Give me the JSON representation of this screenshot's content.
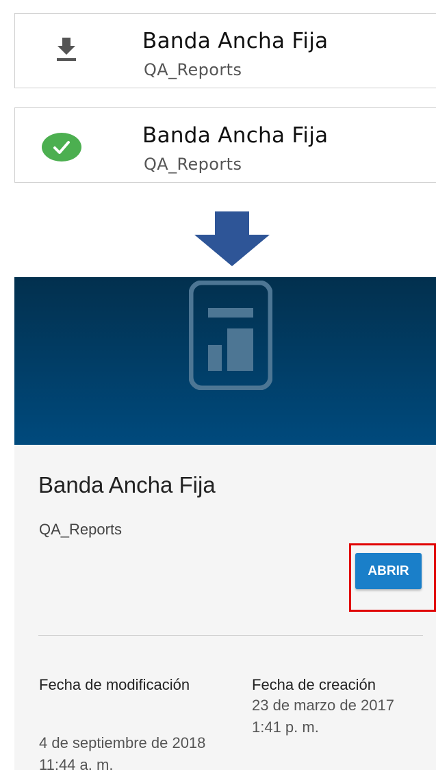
{
  "list_items": [
    {
      "title": "Banda Ancha Fija",
      "subtitle": "QA_Reports",
      "icon": "download-icon"
    },
    {
      "title": "Banda Ancha Fija",
      "subtitle": "QA_Reports",
      "icon": "check-circle-icon"
    }
  ],
  "arrow_icon": "arrow-down-icon",
  "detail": {
    "banner_icon": "report-icon",
    "title": "Banda Ancha Fija",
    "subtitle": "QA_Reports",
    "open_label": "ABRIR",
    "modified_label": "Fecha de modificación",
    "modified_value": "4 de septiembre de 2018 11:44 a. m.",
    "created_label": "Fecha de creación",
    "created_value": "23 de marzo de 2017 1:41 p. m."
  },
  "colors": {
    "banner": "#004a7d",
    "open_button": "#1a7fc9",
    "success": "#4caf50",
    "arrow": "#2e5597",
    "highlight": "#e00000"
  }
}
